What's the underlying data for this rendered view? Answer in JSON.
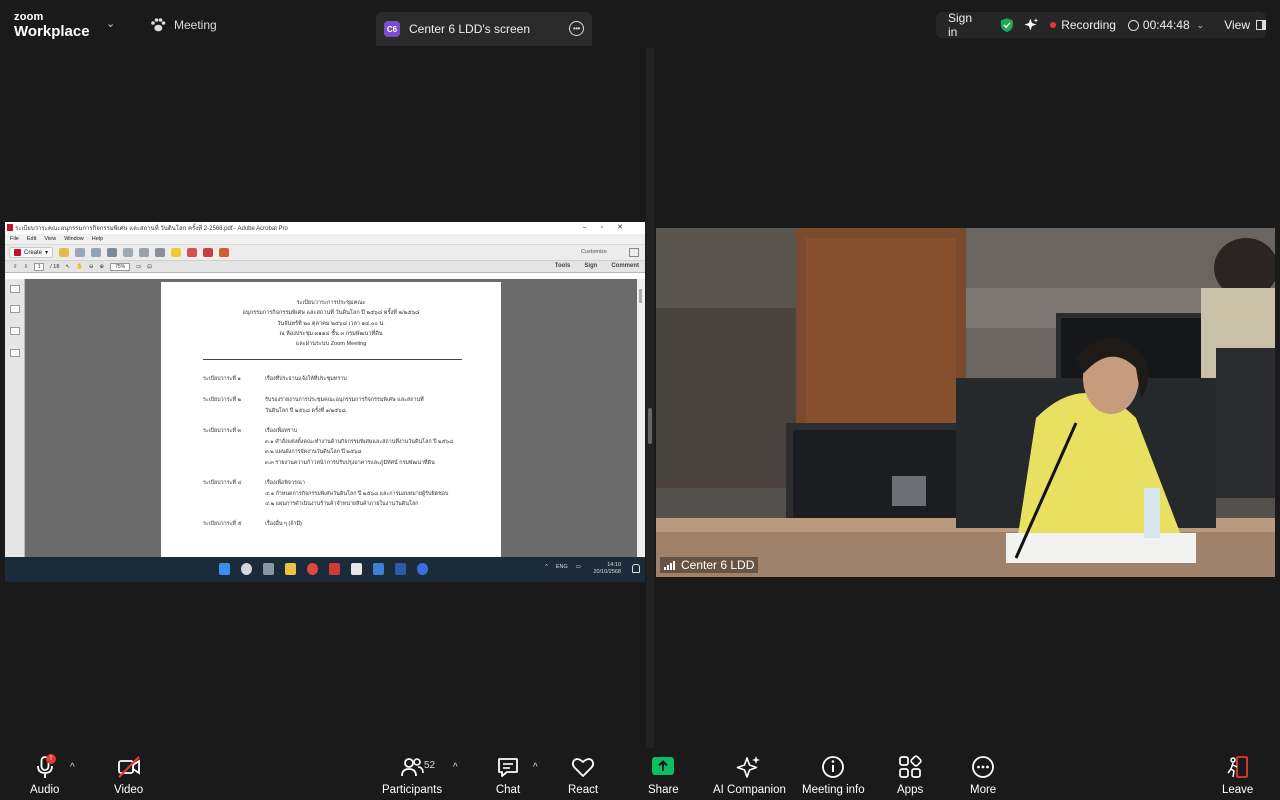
{
  "app": {
    "logo_top": "zoom",
    "logo_bottom": "Workplace",
    "meeting_label": "Meeting",
    "screen_tab_badge": "C6",
    "screen_tab_title": "Center 6 LDD's screen"
  },
  "status": {
    "signin": "Sign in",
    "recording": "Recording",
    "timer": "00:44:48",
    "view": "View",
    "recording_color": "#e53935",
    "shield_color": "#1faa59"
  },
  "acrobat": {
    "window_title": "ระเบียบวาระคณะอนุกรรมการกิจกรรมพิเศษ และสถานที่ วันดินโลก ครั้งที่ 2-2568.pdf - Adobe Acrobat Pro",
    "menu": [
      "File",
      "Edit",
      "View",
      "Window",
      "Help"
    ],
    "create_label": "Create",
    "customize_label": "Customize",
    "page_current": "1",
    "page_total": "/ 18",
    "zoom": "75%",
    "links": [
      "Tools",
      "Sign",
      "Comment"
    ]
  },
  "document": {
    "header_lines": [
      "ระเบียบวาระการประชุมคณะ",
      "อนุกรรมการกิจกรรมพิเศษ และสถานที่ วันดินโลก ปี ๒๕๖๘ ครั้งที่ ๒/๒๕๖๘",
      "วันจันทร์ที่ ๒๐ ตุลาคม ๒๕๖๘ เวลา ๑๔.๐๐ น.",
      "ณ ห้องประชุม ๓๑๑๔ ชั้น ๓ กรมพัฒนาที่ดิน",
      "และผ่านระบบ Zoom Meeting"
    ],
    "agenda": [
      {
        "label": "ระเบียบวาระที่ ๑",
        "lines": [
          "เรื่องที่ประธานแจ้งให้ที่ประชุมทราบ"
        ]
      },
      {
        "label": "ระเบียบวาระที่ ๒",
        "lines": [
          "รับรองรายงานการประชุมคณะอนุกรรมการกิจกรรมพิเศษ และสถานที่",
          "วันดินโลก ปี ๒๕๖๘ ครั้งที่ ๑/๒๕๖๘"
        ]
      },
      {
        "label": "ระเบียบวาระที่ ๓",
        "lines": [
          "เรื่องเพื่อทราบ",
          "๓.๑ คำสั่งแต่งตั้งคณะทำงานด้านกิจกรรมพิเศษและสถานที่งานวันดินโลก ปี ๒๕๖๘",
          "๓.๒ แผนผังการจัดงานวันดินโลก ปี ๒๕๖๘",
          "๓.๓ รายงานความก้าวหน้าการปรับปรุงอาคารและภูมิทัศน์ กรมพัฒนาที่ดิน"
        ]
      },
      {
        "label": "ระเบียบวาระที่ ๔",
        "lines": [
          "เรื่องเพื่อพิจารณา",
          "๔.๑ กำหนดการกิจกรรมพิเศษวันดินโลก ปี ๒๕๖๘ และการมอบหมายผู้รับผิดชอบ",
          "๔.๒ แผนการดำเนินงานร้านค้าจำหน่ายสินค้าภายในงานวันดินโลก"
        ]
      },
      {
        "label": "ระเบียบวาระที่ ๕",
        "lines": [
          "เรื่องอื่น ๆ (ถ้ามี)"
        ]
      }
    ]
  },
  "taskbar": {
    "lang": "ENG",
    "time": "14:10",
    "date": "20/10/2568"
  },
  "video": {
    "participant_name": "Center 6 LDD"
  },
  "toolbar": {
    "audio": "Audio",
    "video": "Video",
    "participants": "Participants",
    "participants_count": "52",
    "chat": "Chat",
    "react": "React",
    "share": "Share",
    "ai_companion": "AI Companion",
    "meeting_info": "Meeting info",
    "apps": "Apps",
    "more": "More",
    "leave": "Leave",
    "share_color": "#0bbd63",
    "leave_color": "#e53935"
  }
}
